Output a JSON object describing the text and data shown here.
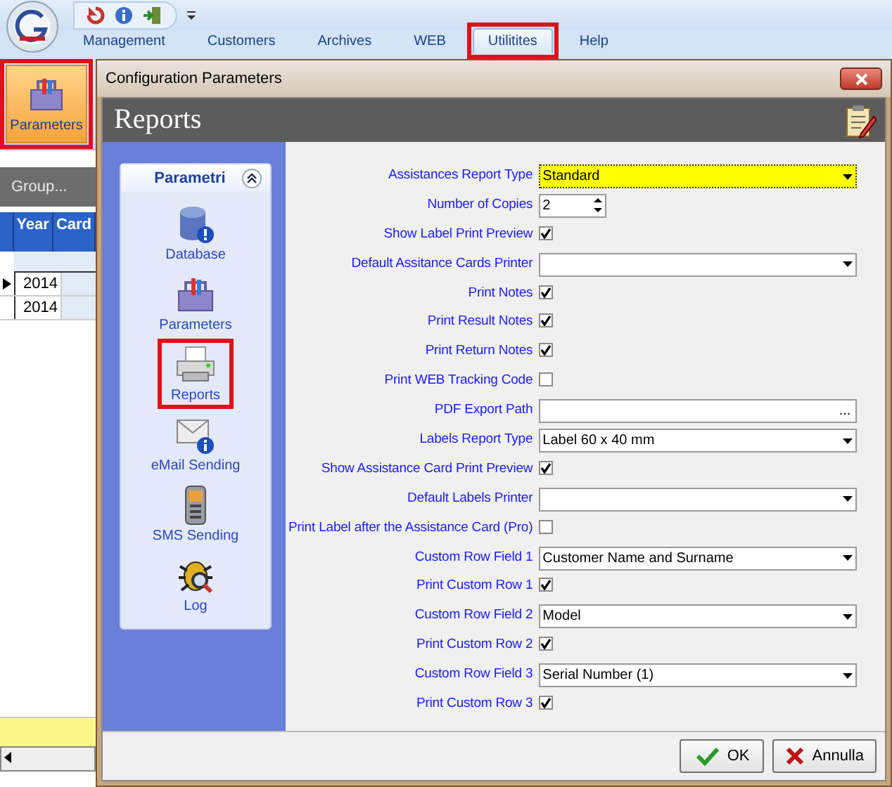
{
  "ribbon": {
    "tabs": [
      {
        "label": "Management",
        "selected": false,
        "highlighted": false
      },
      {
        "label": "Customers",
        "selected": false,
        "highlighted": false
      },
      {
        "label": "Archives",
        "selected": false,
        "highlighted": false
      },
      {
        "label": "WEB",
        "selected": false,
        "highlighted": false
      },
      {
        "label": "Utilitites",
        "selected": true,
        "highlighted": true
      },
      {
        "label": "Help",
        "selected": false,
        "highlighted": false
      }
    ],
    "buttons": [
      {
        "label": "Parameters",
        "highlighted": true
      }
    ]
  },
  "grid": {
    "group_hint": "Group...",
    "columns": [
      "Year",
      "Card"
    ],
    "rows": [
      {
        "year": "2014",
        "current": true
      },
      {
        "year": "2014",
        "current": false
      }
    ]
  },
  "dialog": {
    "title": "Configuration Parameters",
    "header": "Reports",
    "nav": {
      "title": "Parametri",
      "items": [
        {
          "label": "Database",
          "kind": "database",
          "highlighted": false
        },
        {
          "label": "Parameters",
          "kind": "toolbox",
          "highlighted": false
        },
        {
          "label": "Reports",
          "kind": "printer",
          "highlighted": true
        },
        {
          "label": "eMail Sending",
          "kind": "email",
          "highlighted": false
        },
        {
          "label": "SMS Sending",
          "kind": "phone",
          "highlighted": false
        },
        {
          "label": "Log",
          "kind": "bug",
          "highlighted": false
        }
      ]
    },
    "fields": [
      {
        "label": "Assistances Report Type",
        "kind": "combo",
        "value": "Standard",
        "focused": true
      },
      {
        "label": "Number of Copies",
        "kind": "spin",
        "value": "2"
      },
      {
        "label": "Show Label Print Preview",
        "kind": "check",
        "checked": true
      },
      {
        "label": "Default Assitance Cards Printer",
        "kind": "combo",
        "focused": false
      },
      {
        "label": "Print Notes",
        "kind": "check",
        "checked": true
      },
      {
        "label": "Print Result Notes",
        "kind": "check",
        "checked": true
      },
      {
        "label": "Print Return Notes",
        "kind": "check",
        "checked": true
      },
      {
        "label": "Print WEB Tracking Code",
        "kind": "check",
        "checked": false
      },
      {
        "label": "PDF Export Path",
        "kind": "path",
        "button": "..."
      },
      {
        "label": "Labels Report Type",
        "kind": "combo",
        "value": "Label 60 x 40 mm",
        "focused": false
      },
      {
        "label": "Show Assistance Card Print Preview",
        "kind": "check",
        "checked": true
      },
      {
        "label": "Default Labels Printer",
        "kind": "combo",
        "focused": false
      },
      {
        "label": "Print Label after the Assistance Card (Pro)",
        "kind": "check",
        "checked": false
      },
      {
        "label": "Custom Row Field 1",
        "kind": "combo",
        "value": "Customer Name and Surname",
        "focused": false
      },
      {
        "label": "Print Custom Row 1",
        "kind": "check",
        "checked": true
      },
      {
        "label": "Custom Row Field 2",
        "kind": "combo",
        "value": "Model",
        "focused": false
      },
      {
        "label": "Print Custom Row 2",
        "kind": "check",
        "checked": true
      },
      {
        "label": "Custom Row Field 3",
        "kind": "combo",
        "value": "Serial Number (1)",
        "focused": false
      },
      {
        "label": "Print Custom Row 3",
        "kind": "check",
        "checked": true
      }
    ],
    "buttons": [
      {
        "label": "OK",
        "kind": "ok"
      },
      {
        "label": "Annulla",
        "kind": "cancel"
      }
    ]
  }
}
